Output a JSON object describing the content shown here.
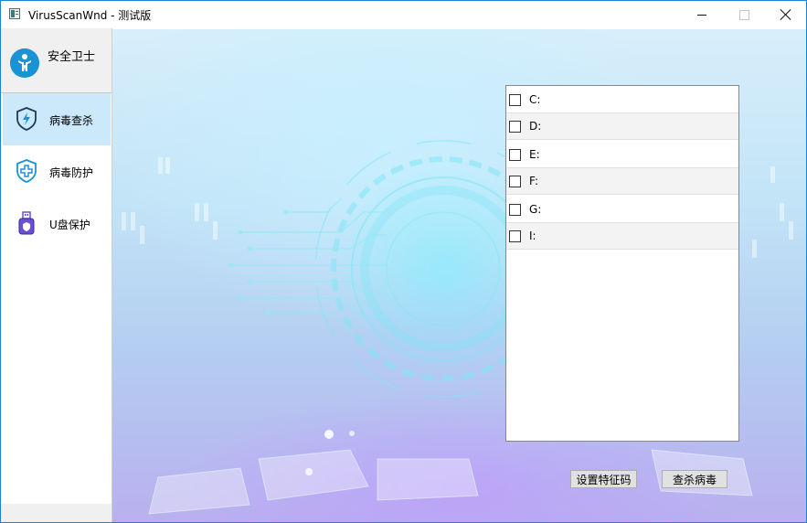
{
  "window": {
    "title": "VirusScanWnd - 测试版"
  },
  "sidebar": {
    "brand_label": "安全卫士",
    "brand_icon": "guard-person-icon",
    "items": [
      {
        "label": "病毒查杀",
        "icon": "lightning-shield-icon",
        "active": true
      },
      {
        "label": "病毒防护",
        "icon": "cross-shield-icon",
        "active": false
      },
      {
        "label": "U盘保护",
        "icon": "usb-drive-icon",
        "active": false
      }
    ]
  },
  "drives": [
    {
      "label": "C:",
      "checked": false
    },
    {
      "label": "D:",
      "checked": false
    },
    {
      "label": "E:",
      "checked": false
    },
    {
      "label": "F:",
      "checked": false
    },
    {
      "label": "G:",
      "checked": false
    },
    {
      "label": "I:",
      "checked": false
    }
  ],
  "actions": {
    "set_signature_label": "设置特征码",
    "scan_virus_label": "查杀病毒"
  },
  "colors": {
    "accent": "#1993d4",
    "active_nav_bg": "#cce8fb",
    "usb_icon": "#6a4fd6"
  }
}
